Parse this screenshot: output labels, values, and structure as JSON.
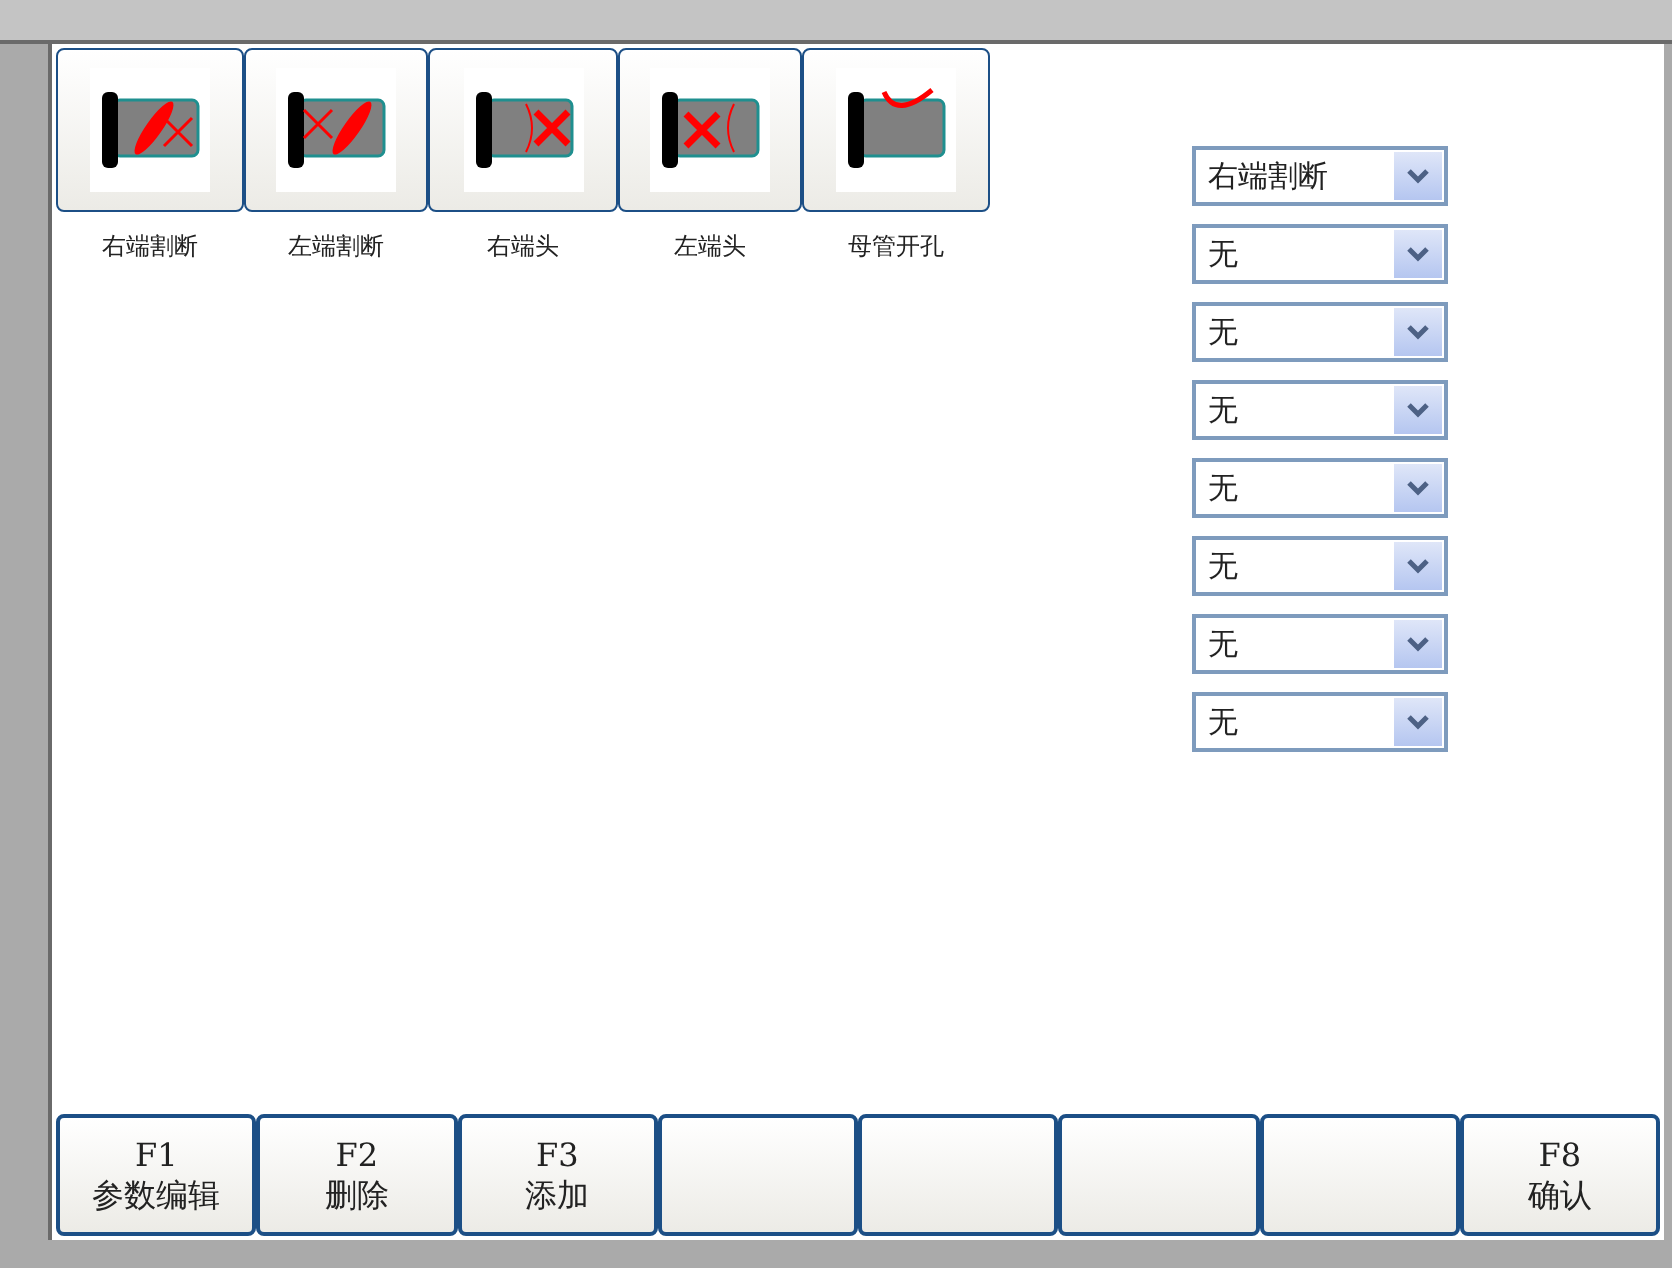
{
  "tools": [
    {
      "kind": "right-cut",
      "label": "右端割断"
    },
    {
      "kind": "left-cut",
      "label": "左端割断"
    },
    {
      "kind": "right-end",
      "label": "右端头"
    },
    {
      "kind": "left-end",
      "label": "左端头"
    },
    {
      "kind": "branch-hole",
      "label": "母管开孔"
    }
  ],
  "selects": [
    {
      "value": "右端割断"
    },
    {
      "value": "无"
    },
    {
      "value": "无"
    },
    {
      "value": "无"
    },
    {
      "value": "无"
    },
    {
      "value": "无"
    },
    {
      "value": "无"
    },
    {
      "value": "无"
    }
  ],
  "function_keys": [
    {
      "kind": "key",
      "key": "F1",
      "label": "参数编辑"
    },
    {
      "kind": "key",
      "key": "F2",
      "label": "删除"
    },
    {
      "kind": "key",
      "key": "F3",
      "label": "添加"
    },
    {
      "kind": "empty"
    },
    {
      "kind": "empty"
    },
    {
      "kind": "empty"
    },
    {
      "kind": "empty"
    },
    {
      "kind": "key",
      "key": "F8",
      "label": "确认"
    }
  ]
}
